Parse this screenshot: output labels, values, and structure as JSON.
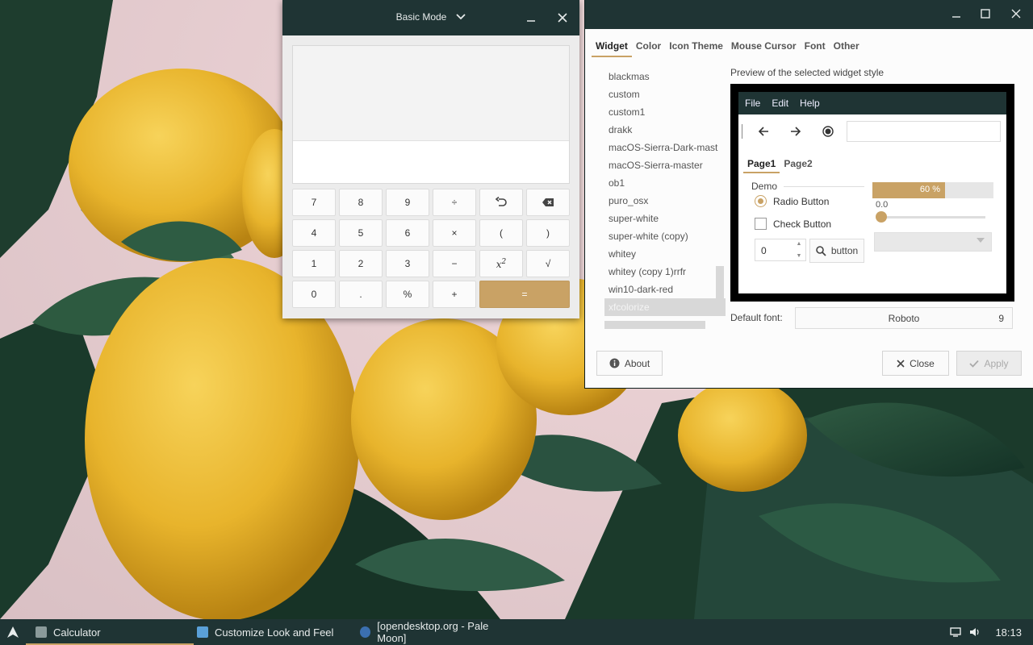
{
  "calculator": {
    "mode": "Basic Mode",
    "keys": [
      {
        "name": "key-7",
        "label": "7"
      },
      {
        "name": "key-8",
        "label": "8"
      },
      {
        "name": "key-9",
        "label": "9"
      },
      {
        "name": "key-divide",
        "label": "÷"
      },
      {
        "name": "key-undo",
        "label": "↶",
        "icon": "undo-icon"
      },
      {
        "name": "key-backspace",
        "label": "",
        "icon": "backspace-icon"
      },
      {
        "name": "key-4",
        "label": "4"
      },
      {
        "name": "key-5",
        "label": "5"
      },
      {
        "name": "key-6",
        "label": "6"
      },
      {
        "name": "key-multiply",
        "label": "×"
      },
      {
        "name": "key-open-paren",
        "label": "("
      },
      {
        "name": "key-close-paren",
        "label": ")"
      },
      {
        "name": "key-1",
        "label": "1"
      },
      {
        "name": "key-2",
        "label": "2"
      },
      {
        "name": "key-3",
        "label": "3"
      },
      {
        "name": "key-subtract",
        "label": "−"
      },
      {
        "name": "key-square",
        "label": "x²"
      },
      {
        "name": "key-sqrt",
        "label": "√"
      },
      {
        "name": "key-0",
        "label": "0"
      },
      {
        "name": "key-decimal",
        "label": "."
      },
      {
        "name": "key-percent",
        "label": "%"
      },
      {
        "name": "key-add",
        "label": "+"
      },
      {
        "name": "key-equals",
        "label": "="
      }
    ],
    "accent": "#c9a265"
  },
  "appearance": {
    "tabs": [
      "Widget",
      "Color",
      "Icon Theme",
      "Mouse Cursor",
      "Font",
      "Other"
    ],
    "active_tab": "Widget",
    "themes": [
      "blackmas",
      "custom",
      "custom1",
      "drakk",
      "macOS-Sierra-Dark-mast",
      "macOS-Sierra-master",
      "ob1",
      "puro_osx",
      "super-white",
      "super-white (copy)",
      "whitey",
      "whitey (copy 1)rrfr",
      "win10-dark-red",
      "xfcolorize"
    ],
    "selected_theme": "xfcolorize",
    "preview_label": "Preview of the selected widget style",
    "preview": {
      "menu": [
        "File",
        "Edit",
        "Help"
      ],
      "tabs": [
        "Page1",
        "Page2"
      ],
      "frame_label": "Demo",
      "radio_label": "Radio Button",
      "check_label": "Check Button",
      "spin_value": "0",
      "button_label": "button",
      "progress_text": "60 %",
      "progress_fraction": 0.6,
      "scale_value": "0.0"
    },
    "default_font_label": "Default font:",
    "font_name": "Roboto",
    "font_size": "9",
    "about_label": "About",
    "close_label": "Close",
    "apply_label": "Apply"
  },
  "taskbar": {
    "tasks": [
      {
        "label": "Calculator",
        "icon": "calculator-icon",
        "active": true
      },
      {
        "label": "Customize Look and Feel",
        "icon": "appearance-icon",
        "active": false
      },
      {
        "label": "[opendesktop.org - Pale Moon]",
        "icon": "palemoon-icon",
        "active": false
      }
    ],
    "clock": "18:13"
  },
  "colors": {
    "titlebar": "#1f3434",
    "accent": "#c9a265"
  }
}
